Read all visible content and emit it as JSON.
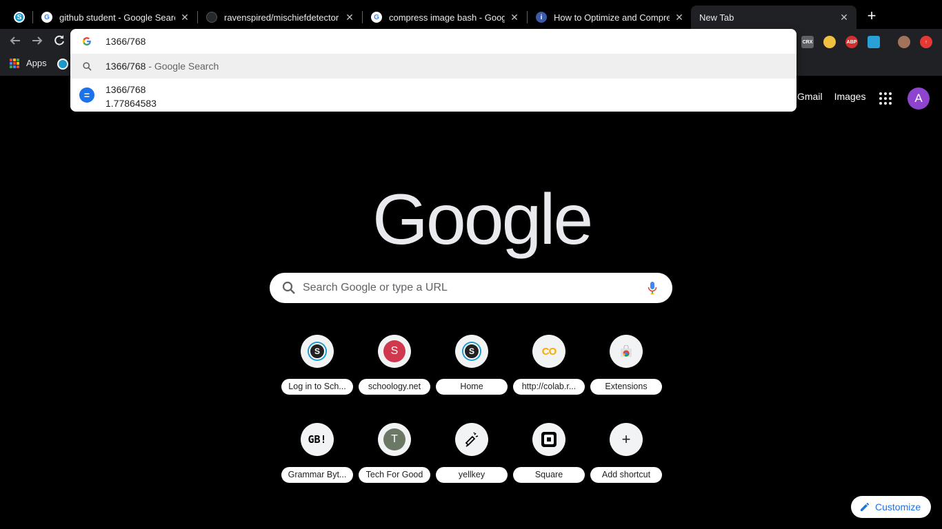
{
  "tabs": [
    {
      "title": "",
      "favicon": "schoology-icon"
    },
    {
      "title": "github student - Google Search",
      "favicon": "google-icon"
    },
    {
      "title": "ravenspired/mischiefdetector",
      "favicon": "github-icon"
    },
    {
      "title": "compress image bash - Google Search",
      "favicon": "google-icon"
    },
    {
      "title": "How to Optimize and Compress",
      "favicon": "info-icon"
    },
    {
      "title": "New Tab",
      "favicon": ""
    }
  ],
  "toolbar": {
    "extensions": [
      "CRX",
      "",
      "ABP",
      "",
      "",
      ""
    ]
  },
  "bookmarks": {
    "apps_label": "Apps"
  },
  "omnibox": {
    "input_value": "1366/768",
    "suggestion_search_query": "1366/768",
    "suggestion_search_suffix": "- Google Search",
    "calc_expression": "1366/768",
    "calc_result": "1.77864583"
  },
  "ntp": {
    "gmail_label": "Gmail",
    "images_label": "Images",
    "avatar_letter": "A",
    "logo_text": "Google",
    "search_placeholder": "Search Google or type a URL",
    "customize_label": "Customize",
    "shortcuts": [
      {
        "label": "Log in to Sch...",
        "icon": "S"
      },
      {
        "label": "schoology.net",
        "icon": "S"
      },
      {
        "label": "Home",
        "icon": "S"
      },
      {
        "label": "http://colab.r...",
        "icon": "CO"
      },
      {
        "label": "Extensions",
        "icon": ""
      },
      {
        "label": "Grammar Byt...",
        "icon": "GB!"
      },
      {
        "label": "Tech For Good",
        "icon": "T"
      },
      {
        "label": "yellkey",
        "icon": ""
      },
      {
        "label": "Square",
        "icon": ""
      },
      {
        "label": "Add shortcut",
        "icon": "+"
      }
    ]
  },
  "colors": {
    "accent": "#1a73e8",
    "background": "#000000",
    "toolbar": "#202124",
    "avatar": "#8e44ce"
  }
}
